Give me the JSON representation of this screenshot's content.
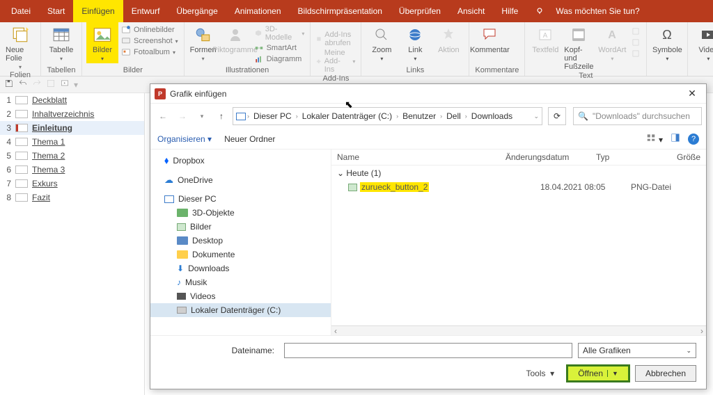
{
  "tabs": {
    "datei": "Datei",
    "start": "Start",
    "einfuegen": "Einfügen",
    "entwurf": "Entwurf",
    "uebergaenge": "Übergänge",
    "animationen": "Animationen",
    "bsp": "Bildschirmpräsentation",
    "ueberpruefen": "Überprüfen",
    "ansicht": "Ansicht",
    "hilfe": "Hilfe",
    "tell": "Was möchten Sie tun?"
  },
  "ribbon": {
    "folien": {
      "neue": "Neue Folie",
      "label": "Folien"
    },
    "tabellen": {
      "tabelle": "Tabelle",
      "label": "Tabellen"
    },
    "bilder": {
      "bilder": "Bilder",
      "online": "Onlinebilder",
      "screenshot": "Screenshot",
      "fotoalbum": "Fotoalbum",
      "label": "Bilder"
    },
    "illus": {
      "formen": "Formen",
      "pikto": "Piktogramme",
      "d3": "3D-Modelle",
      "smart": "SmartArt",
      "dia": "Diagramm",
      "label": "Illustrationen"
    },
    "addins": {
      "get": "Add-Ins abrufen",
      "my": "Meine Add-Ins",
      "label": "Add-Ins"
    },
    "links": {
      "zoom": "Zoom",
      "link": "Link",
      "aktion": "Aktion",
      "label": "Links"
    },
    "komm": {
      "kom": "Kommentar",
      "label": "Kommentare"
    },
    "text": {
      "tf": "Textfeld",
      "kopf": "Kopf- und Fußzeile",
      "wa": "WordArt",
      "label": "Text"
    },
    "sym": {
      "sym": "Symbole",
      "label": ""
    },
    "med": {
      "vid": "Video",
      "label": ""
    }
  },
  "slides": [
    {
      "n": "1",
      "t": "Deckblatt"
    },
    {
      "n": "2",
      "t": "Inhaltverzeichnis"
    },
    {
      "n": "3",
      "t": "Einleitung",
      "sel": true
    },
    {
      "n": "4",
      "t": "Thema 1"
    },
    {
      "n": "5",
      "t": "Thema 2"
    },
    {
      "n": "6",
      "t": "Thema 3"
    },
    {
      "n": "7",
      "t": "Exkurs"
    },
    {
      "n": "8",
      "t": "Fazit"
    }
  ],
  "dialog": {
    "title": "Grafik einfügen",
    "crumbs": [
      "Dieser PC",
      "Lokaler Datenträger (C:)",
      "Benutzer",
      "Dell",
      "Downloads"
    ],
    "search_placeholder": "\"Downloads\" durchsuchen",
    "organize": "Organisieren",
    "newfolder": "Neuer Ordner",
    "tree": {
      "dropbox": "Dropbox",
      "onedrive": "OneDrive",
      "pc": "Dieser PC",
      "d3": "3D-Objekte",
      "bilder": "Bilder",
      "desktop": "Desktop",
      "dokumente": "Dokumente",
      "downloads": "Downloads",
      "musik": "Musik",
      "videos": "Videos",
      "disk": "Lokaler Datenträger (C:)"
    },
    "cols": {
      "name": "Name",
      "date": "Änderungsdatum",
      "type": "Typ",
      "size": "Größe"
    },
    "group": "Heute (1)",
    "file": {
      "name": "zurueck_button_2",
      "date": "18.04.2021 08:05",
      "type": "PNG-Datei"
    },
    "fname_label": "Dateiname:",
    "filter": "Alle Grafiken",
    "tools": "Tools",
    "open": "Öffnen",
    "cancel": "Abbrechen"
  }
}
